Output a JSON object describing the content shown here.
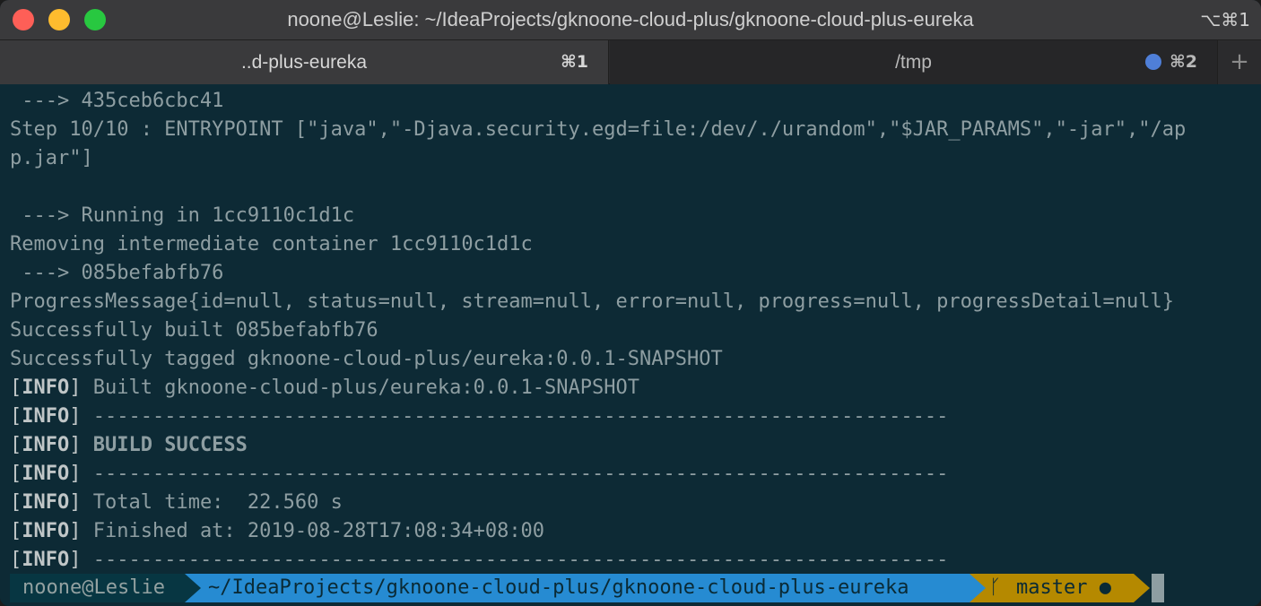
{
  "window": {
    "title": "noone@Leslie: ~/IdeaProjects/gknoone-cloud-plus/gknoone-cloud-plus-eureka",
    "shortcut": "⌥⌘1"
  },
  "tabs": [
    {
      "label": "..d-plus-eureka",
      "key": "⌘1"
    },
    {
      "label": "/tmp",
      "key": "⌘2"
    }
  ],
  "new_tab_label": "+",
  "terminal": {
    "lines": [
      " ---> 435ceb6cbc41",
      "Step 10/10 : ENTRYPOINT [\"java\",\"-Djava.security.egd=file:/dev/./urandom\",\"$JAR_PARAMS\",\"-jar\",\"/ap",
      "p.jar\"]",
      "",
      " ---> Running in 1cc9110c1d1c",
      "Removing intermediate container 1cc9110c1d1c",
      " ---> 085befabfb76",
      "ProgressMessage{id=null, status=null, stream=null, error=null, progress=null, progressDetail=null}",
      "Successfully built 085befabfb76",
      "Successfully tagged gknoone-cloud-plus/eureka:0.0.1-SNAPSHOT"
    ],
    "info_prefix": "INFO",
    "info_lines": [
      {
        "text": "Built gknoone-cloud-plus/eureka:0.0.1-SNAPSHOT",
        "bold": false
      },
      {
        "text": "------------------------------------------------------------------------",
        "bold": false
      },
      {
        "text": "BUILD SUCCESS",
        "bold": true
      },
      {
        "text": "------------------------------------------------------------------------",
        "bold": false
      },
      {
        "text": "Total time:  22.560 s",
        "bold": false
      },
      {
        "text": "Finished at: 2019-08-28T17:08:34+08:00",
        "bold": false
      },
      {
        "text": "------------------------------------------------------------------------",
        "bold": false
      }
    ]
  },
  "prompt": {
    "user": "noone@Leslie",
    "path": "~/IdeaProjects/gknoone-cloud-plus/gknoone-cloud-plus-eureka",
    "branch": "master ●",
    "branch_icon": "ᚴ"
  },
  "colors": {
    "terminal_bg": "#0d2a35",
    "text": "#8e9ea2",
    "prompt_user_bg": "#073642",
    "prompt_path_bg": "#268bd2",
    "prompt_git_bg": "#b58900"
  }
}
